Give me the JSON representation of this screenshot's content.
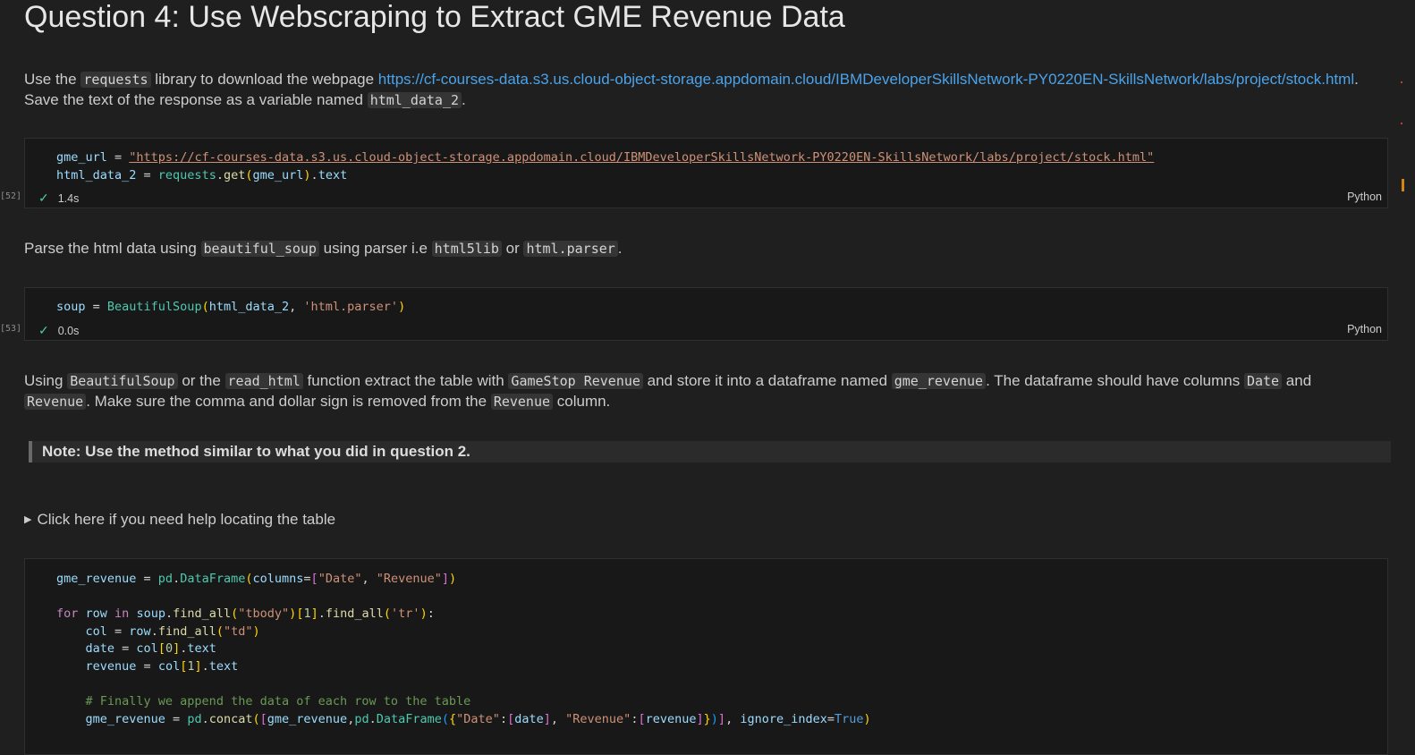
{
  "heading": "Question 4: Use Webscraping to Extract GME Revenue Data",
  "md1": {
    "t1": "Use the ",
    "c1": "requests",
    "t2": " library to download the webpage ",
    "link": "https://cf-courses-data.s3.us.cloud-object-storage.appdomain.cloud/IBMDeveloperSkillsNetwork-PY0220EN-SkillsNetwork/labs/project/stock.html",
    "t3": ".",
    "t4": "Save the text of the response as a variable named ",
    "c2": "html_data_2",
    "t5": "."
  },
  "cell1": {
    "exec_count": "[52]",
    "line1": {
      "var": "gme_url",
      "eq": " = ",
      "str": "\"https://cf-courses-data.s3.us.cloud-object-storage.appdomain.cloud/IBMDeveloperSkillsNetwork-PY0220EN-SkillsNetwork/labs/project/stock.html\""
    },
    "line2": {
      "var": "html_data_2",
      "eq": " = ",
      "mod": "requests",
      "dot1": ".",
      "fn": "get",
      "open": "(",
      "arg": "gme_url",
      "close": ")",
      "dot2": ".",
      "attr": "text"
    },
    "time": "1.4s",
    "language": "Python"
  },
  "md2": {
    "t1": "Parse the html data using ",
    "c1": "beautiful_soup",
    "t2": " using parser i.e ",
    "c2": "html5lib",
    "t3": " or ",
    "c3": "html.parser",
    "t4": "."
  },
  "cell2": {
    "exec_count": "[53]",
    "line1": {
      "var": "soup",
      "eq": " = ",
      "cls": "BeautifulSoup",
      "open": "(",
      "arg1": "html_data_2",
      "comma": ", ",
      "str": "'html.parser'",
      "close": ")"
    },
    "time": "0.0s",
    "language": "Python"
  },
  "md3": {
    "t1": "Using ",
    "c1": "BeautifulSoup",
    "t2": " or the ",
    "c2": "read_html",
    "t3": " function extract the table with ",
    "c3": "GameStop Revenue",
    "t4": " and store it into a dataframe named ",
    "c4": "gme_revenue",
    "t5": ". The dataframe should have columns ",
    "c5": "Date",
    "t6": " and",
    "c6": "Revenue",
    "t7": ". Make sure the comma and dollar sign is removed from the ",
    "c7": "Revenue",
    "t8": " column."
  },
  "note": "Note: Use the method similar to what you did in question 2.",
  "details": {
    "triangle": "▶",
    "label": "Click here if you need help locating the table"
  },
  "cell3": {
    "l1": {
      "var": "gme_revenue",
      "eq": " = ",
      "mod": "pd",
      "dot": ".",
      "cls": "DataFrame",
      "open": "(",
      "kw": "columns",
      "eq2": "=",
      "lb": "[",
      "s1": "\"Date\"",
      "comma": ", ",
      "s2": "\"Revenue\"",
      "rb": "]",
      "close": ")"
    },
    "l2": {
      "for": "for",
      "sp1": " ",
      "row": "row",
      "in": " in ",
      "soup": "soup",
      "dot": ".",
      "fa1": "find_all",
      "o1": "(",
      "s1": "\"tbody\"",
      "c1": ")",
      "lb": "[",
      "num": "1",
      "rb": "]",
      "dot2": ".",
      "fa2": "find_all",
      "o2": "(",
      "s2": "'tr'",
      "c2": ")",
      "colon": ":"
    },
    "l3": {
      "indent": "    ",
      "var": "col",
      "eq": " = ",
      "row": "row",
      "dot": ".",
      "fn": "find_all",
      "o": "(",
      "s": "\"td\"",
      "c": ")"
    },
    "l4": {
      "indent": "    ",
      "var": "date",
      "eq": " = ",
      "col": "col",
      "lb": "[",
      "num": "0",
      "rb": "]",
      "dot": ".",
      "attr": "text"
    },
    "l5": {
      "indent": "    ",
      "var": "revenue",
      "eq": " = ",
      "col": "col",
      "lb": "[",
      "num": "1",
      "rb": "]",
      "dot": ".",
      "attr": "text"
    },
    "l6": {
      "indent": "    ",
      "comment": "# Finally we append the data of each row to the table"
    },
    "l7": {
      "indent": "    ",
      "var": "gme_revenue",
      "eq": " = ",
      "mod": "pd",
      "dot": ".",
      "fn": "concat",
      "o1": "(",
      "lb": "[",
      "a1": "gme_revenue",
      "comma1": ",",
      "mod2": "pd",
      "dot2": ".",
      "cls": "DataFrame",
      "o2": "(",
      "lc": "{",
      "s1": "\"Date\"",
      "colon1": ":",
      "lb2": "[",
      "a2": "date",
      "rb2": "]",
      "comma2": ", ",
      "s2": "\"Revenue\"",
      "colon2": ":",
      "lb3": "[",
      "a3": "revenue",
      "rb3": "]",
      "rc": "}",
      "c2": ")",
      "rb": "]",
      "comma3": ", ",
      "kw": "ignore_index",
      "eq2": "=",
      "true": "True",
      "c1": ")"
    }
  }
}
